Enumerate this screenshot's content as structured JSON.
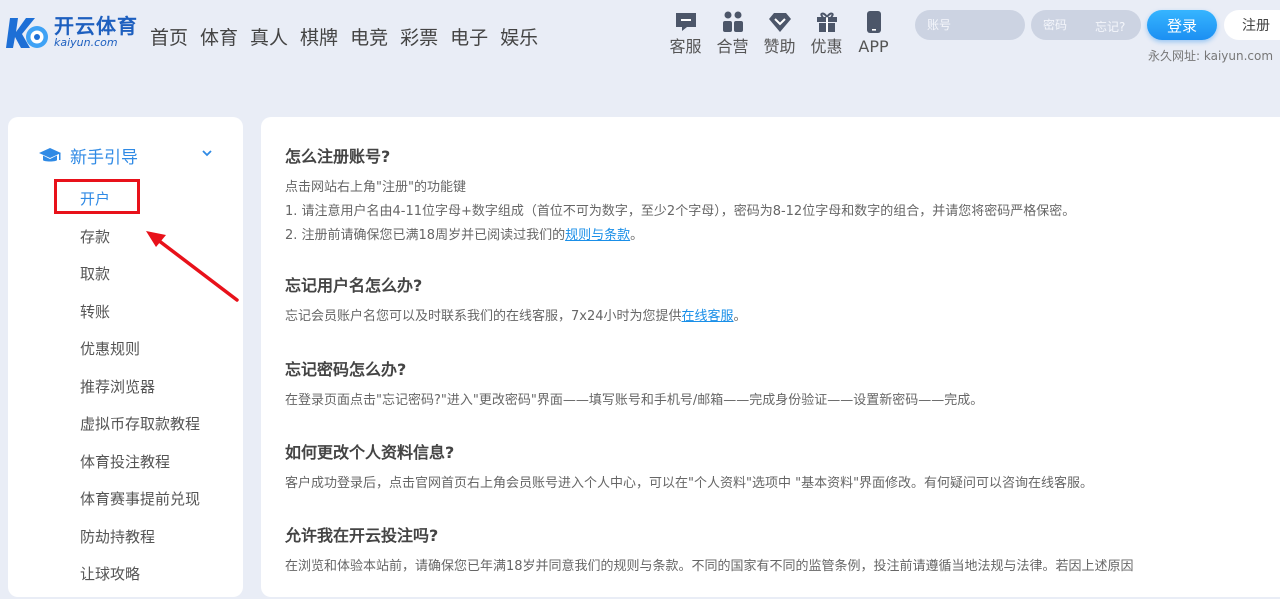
{
  "header": {
    "logo": {
      "name": "开云体育",
      "domain": "kaiyun.com"
    },
    "nav": [
      "首页",
      "体育",
      "真人",
      "棋牌",
      "电竞",
      "彩票",
      "电子",
      "娱乐"
    ],
    "quick_links": [
      {
        "label": "客服",
        "icon": "chat-icon"
      },
      {
        "label": "合营",
        "icon": "partner-icon"
      },
      {
        "label": "赞助",
        "icon": "diamond-icon"
      },
      {
        "label": "优惠",
        "icon": "gift-icon"
      },
      {
        "label": "APP",
        "icon": "phone-icon"
      }
    ],
    "login": {
      "account_placeholder": "账号",
      "password_placeholder": "密码",
      "forgot": "忘记?",
      "login_label": "登录",
      "register_label": "注册"
    },
    "permanent_url": "永久网址: kaiyun.com"
  },
  "sidebar": {
    "title": "新手引导",
    "items": [
      "开户",
      "存款",
      "取款",
      "转账",
      "优惠规则",
      "推荐浏览器",
      "虚拟币存取款教程",
      "体育投注教程",
      "体育赛事提前兑现",
      "防劫持教程",
      "让球攻略"
    ],
    "active_index": 0
  },
  "faq": [
    {
      "q": "怎么注册账号?",
      "lines": [
        "点击网站右上角\"注册\"的功能键",
        "1. 请注意用户名由4-11位字母+数字组成（首位不可为数字，至少2个字母），密码为8-12位字母和数字的组合，并请您将密码严格保密。"
      ],
      "line3_pre": "2. 注册前请确保您已满18周岁并已阅读过我们的",
      "line3_link": "规则与条款",
      "line3_post": "。"
    },
    {
      "q": "忘记用户名怎么办?",
      "pre": "忘记会员账户名您可以及时联系我们的在线客服，7x24小时为您提供",
      "link": "在线客服",
      "post": "。"
    },
    {
      "q": "忘记密码怎么办?",
      "text": "在登录页面点击\"忘记密码?\"进入\"更改密码\"界面——填写账号和手机号/邮箱——完成身份验证——设置新密码——完成。"
    },
    {
      "q": "如何更改个人资料信息?",
      "text": "客户成功登录后，点击官网首页右上角会员账号进入个人中心，可以在\"个人资料\"选项中 \"基本资料\"界面修改。有何疑问可以咨询在线客服。"
    },
    {
      "q": "允许我在开云投注吗?",
      "text": "在浏览和体验本站前，请确保您已年满18岁并同意我们的规则与条款。不同的国家有不同的监管条例，投注前请遵循当地法规与法律。若因上述原因"
    }
  ],
  "colors": {
    "accent": "#2f8ae5",
    "link": "#1a8fe8",
    "highlight": "#e8111a",
    "page_bg": "#e9edf6"
  }
}
